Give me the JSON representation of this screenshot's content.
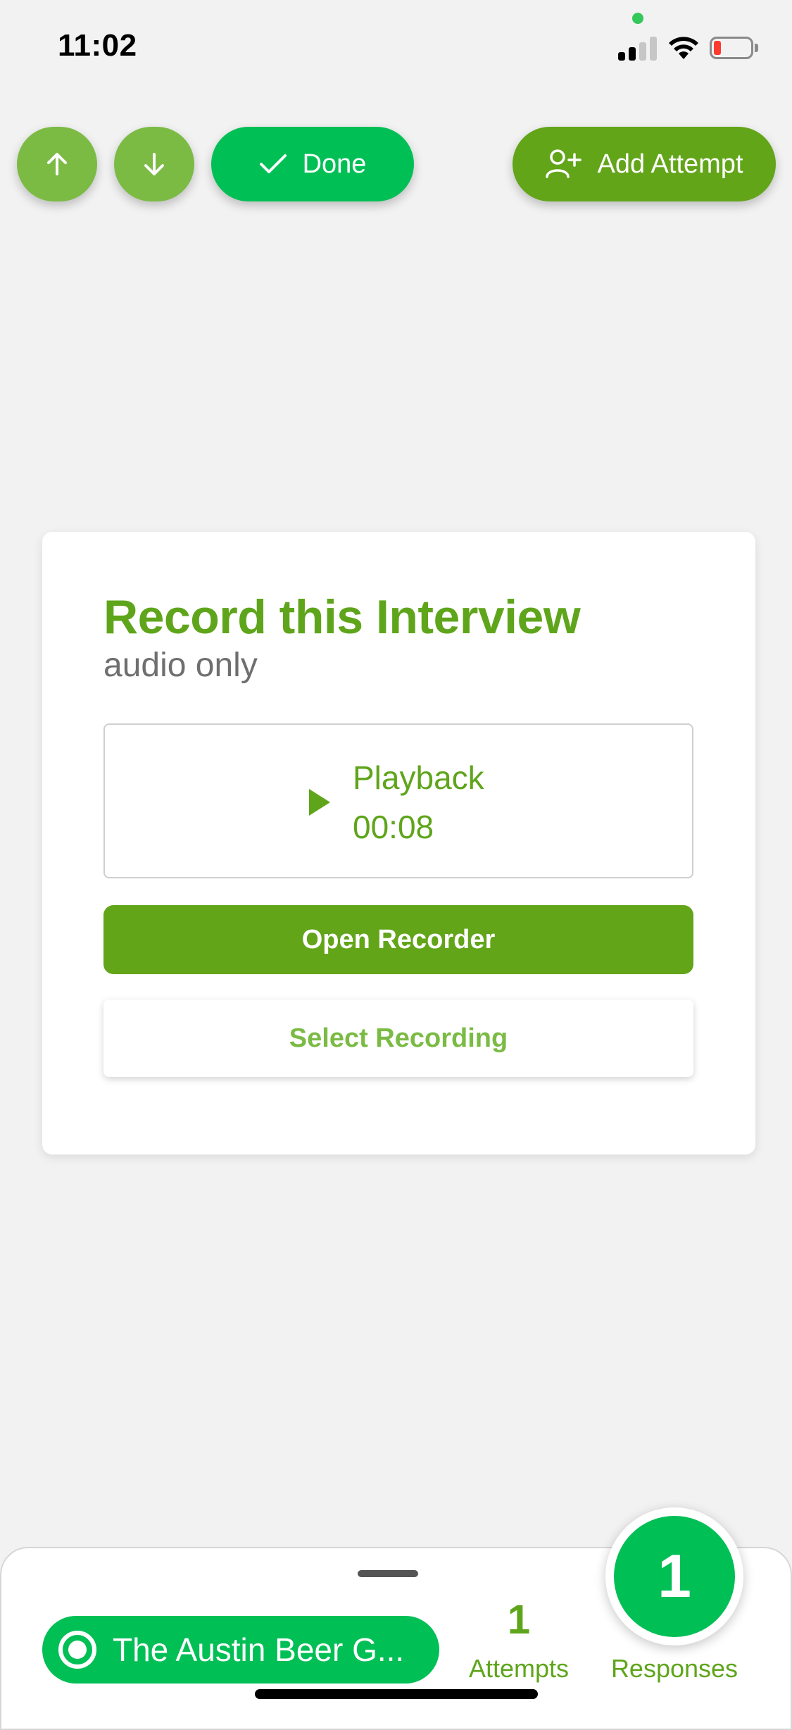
{
  "status_bar": {
    "time": "11:02"
  },
  "toolbar": {
    "up_icon": "arrow-up-icon",
    "down_icon": "arrow-down-icon",
    "done_label": "Done",
    "add_attempt_label": "Add Attempt"
  },
  "card": {
    "title": "Record this Interview",
    "subtitle": "audio only",
    "playback_label": "Playback",
    "playback_time": "00:08",
    "open_recorder_label": "Open Recorder",
    "select_recording_label": "Select Recording"
  },
  "bottom_bar": {
    "survey_name": "The Austin Beer G...",
    "attempts_count": "1",
    "attempts_label": "Attempts",
    "responses_count": "1",
    "responses_label": "Responses"
  },
  "colors": {
    "primary_green": "#00bf55",
    "dark_green": "#62a519",
    "light_green": "#7bbb44",
    "title_green": "#5fa51b"
  }
}
